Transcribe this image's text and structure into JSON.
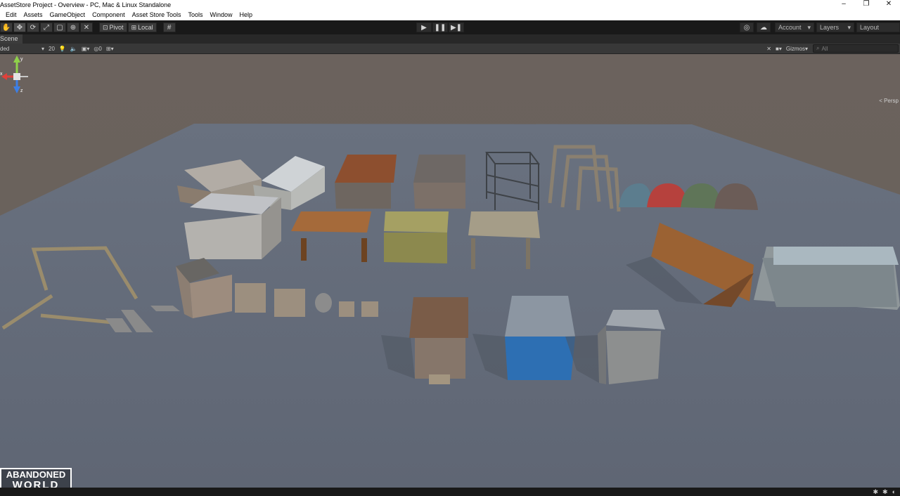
{
  "window": {
    "title": "AssetStore Project - Overview - PC, Mac & Linux Standalone",
    "controls": [
      "–",
      "❐",
      "✕"
    ]
  },
  "menu": [
    "Edit",
    "Assets",
    "GameObject",
    "Component",
    "Asset Store Tools",
    "Tools",
    "Window",
    "Help"
  ],
  "toolbar": {
    "tool_icons": [
      "hand-icon",
      "move-icon",
      "rotate-icon",
      "scale-icon",
      "rect-icon",
      "transform-icon",
      "custom-tool-icon"
    ],
    "pivot_label": "Pivot",
    "local_label": "Local",
    "play_controls": [
      "▶",
      "❚❚",
      "▶❚"
    ],
    "account_label": "Account",
    "layers_label": "Layers",
    "layout_label": "Layout"
  },
  "scene_tab": {
    "label": "Scene"
  },
  "scene_toolbar": {
    "draw_mode": "ded",
    "grid_value": "20",
    "gizmos_label": "Gizmos",
    "search_placeholder": "All",
    "hidden_count": "0"
  },
  "viewport": {
    "persp_label": "Persp",
    "gizmo_axes": [
      "x",
      "y",
      "z"
    ],
    "logo_line1": "ABANDONED",
    "logo_line2": "WORLD",
    "colors": {
      "sky": "#6b625d",
      "ground": "#6a7383",
      "axis_x": "#e0413b",
      "axis_y": "#8fd14a",
      "axis_z": "#3c7fe6"
    }
  }
}
